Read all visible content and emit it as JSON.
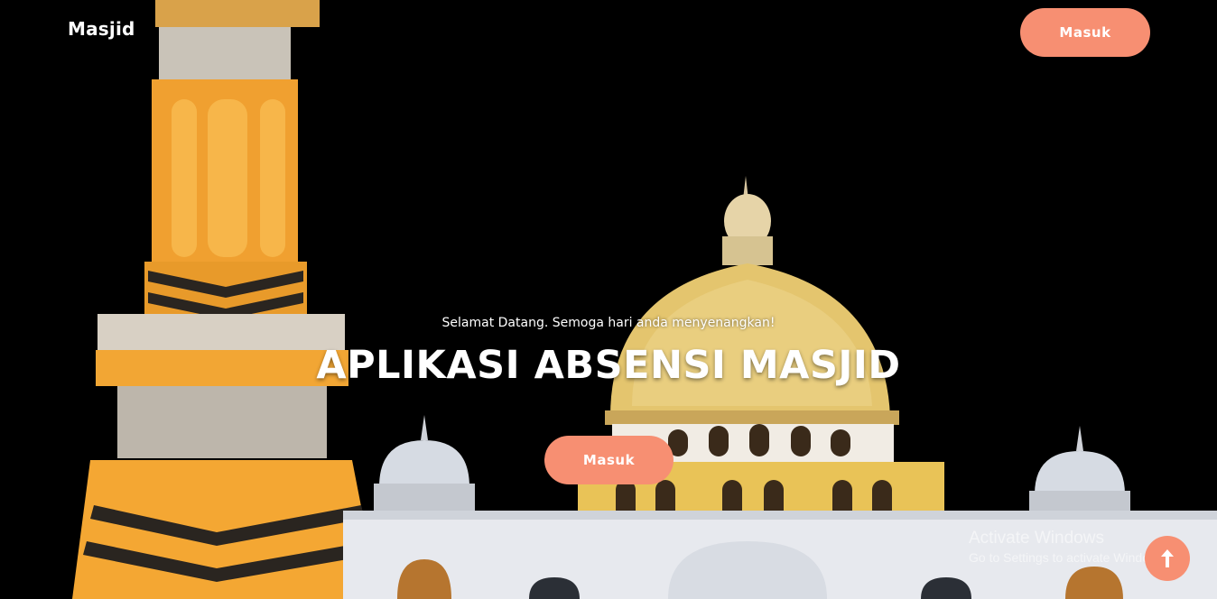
{
  "nav": {
    "brand": "Masjid",
    "login_label": "Masuk"
  },
  "hero": {
    "welcome": "Selamat Datang. Semoga hari anda menyenangkan!",
    "title": "APLIKASI ABSENSI MASJID",
    "cta_label": "Masuk"
  },
  "watermark": {
    "title": "Activate Windows",
    "subtitle": "Go to Settings to activate Windows."
  },
  "colors": {
    "accent": "#f78f72",
    "background": "#000000",
    "gold": "#f5a623",
    "dome": "#e0c06a"
  },
  "icons": {
    "scroll_top": "arrow-up-icon"
  }
}
